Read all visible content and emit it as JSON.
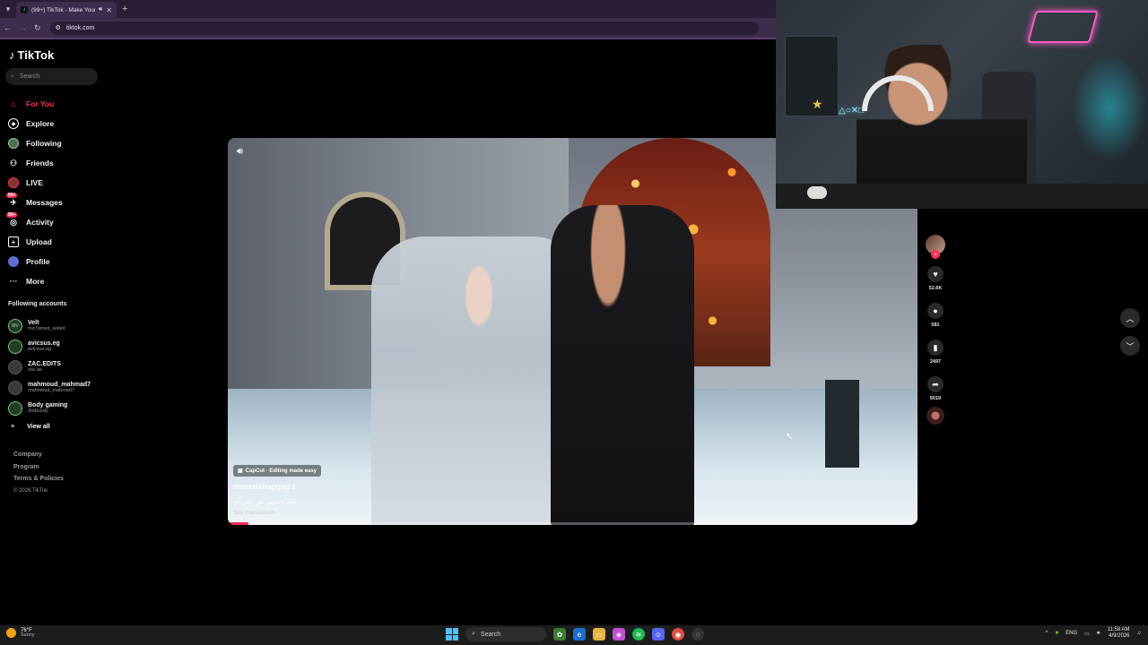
{
  "browser": {
    "tab_title": "(99+) TikTok - Make Your Day",
    "url": "tiktok.com"
  },
  "sidebar": {
    "brand": "TikTok",
    "search_placeholder": "Search",
    "nav": [
      {
        "label": "For You",
        "icon": "home-icon",
        "active": true
      },
      {
        "label": "Explore",
        "icon": "compass-icon"
      },
      {
        "label": "Following",
        "icon": "following-avatar-icon"
      },
      {
        "label": "Friends",
        "icon": "friends-icon"
      },
      {
        "label": "LIVE",
        "icon": "live-icon"
      },
      {
        "label": "Messages",
        "icon": "messages-icon",
        "badge": "99+"
      },
      {
        "label": "Activity",
        "icon": "activity-icon",
        "badge": "99+"
      },
      {
        "label": "Upload",
        "icon": "upload-icon"
      },
      {
        "label": "Profile",
        "icon": "profile-icon"
      },
      {
        "label": "More",
        "icon": "more-icon"
      }
    ],
    "following_heading": "Following accounts",
    "accounts": [
      {
        "name": "Velt",
        "handle": "mo7amed_wvled"
      },
      {
        "name": "avicsus.eg",
        "handle": "avicsus.eg"
      },
      {
        "name": "ZAC.EDITS",
        "handle": "zac.ae"
      },
      {
        "name": "mahmoud_mahmad7",
        "handle": "mahmoud_mahmad7"
      },
      {
        "name": "Body gaming",
        "handle": "3mboody"
      }
    ],
    "view_all": "View all",
    "footer": {
      "company": "Company",
      "program": "Program",
      "terms": "Terms & Policies",
      "copyright": "© 2026 TikTok"
    }
  },
  "video": {
    "capcut_label": "CapCut · Editing made easy",
    "username": "mostafahaggag.1",
    "description": "نفيم لحتوني بس بصراحة",
    "see_translation": "See translation",
    "progress": 0.03
  },
  "actions": {
    "likes": "52.6K",
    "comments": "581",
    "bookmarks": "2497",
    "shares": "5019"
  },
  "taskbar": {
    "temperature": "76°F",
    "weather": "Sunny",
    "search_label": "Search",
    "language": "ENG",
    "time": "11:58 AM",
    "date": "4/9/2026"
  },
  "colors": {
    "accent": "#fe2c55",
    "chrome": "#3d2c4c"
  }
}
